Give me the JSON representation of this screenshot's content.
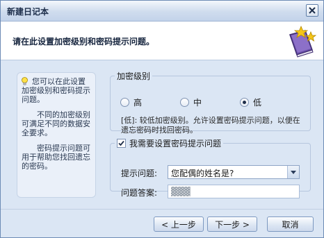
{
  "window": {
    "title": "新建日记本"
  },
  "header": {
    "heading": "请在此设置加密级别和密码提示问题。"
  },
  "tips": {
    "para1": "您可以在此设置加密级别和密码提示问题。",
    "para2": "不同的加密级别可满足不同的数据安全要求。",
    "para3": "密码提示问题可用于帮助您找回遗忘的密码。"
  },
  "encryption": {
    "legend": "加密级别",
    "options": [
      {
        "label": "高",
        "selected": false
      },
      {
        "label": "中",
        "selected": false
      },
      {
        "label": "低",
        "selected": true
      }
    ],
    "description": "[低]: 较低加密级别。允许设置密码提示问题，以便在遗忘密码时找回密码。"
  },
  "hint": {
    "checkbox_label": "我需要设置密码提示问题",
    "checked": true,
    "question_label": "提示问题:",
    "question_value": "您配偶的姓名是?",
    "answer_label": "问题答案:",
    "answer_value": "▓▓▓"
  },
  "footer": {
    "prev_label": "< 上一步",
    "next_label": "下一步 >",
    "cancel_label": "取消"
  },
  "icons": {
    "close": "close-icon",
    "book": "book-stars-icon",
    "bulb": "lightbulb-icon",
    "dropdown": "chevron-down-icon",
    "check": "checkmark-icon"
  },
  "colors": {
    "window_bg": "#dbe6f4",
    "accent_border": "#7c98c0",
    "book_purple": "#6a4fa8",
    "star_gold": "#f5c518"
  }
}
